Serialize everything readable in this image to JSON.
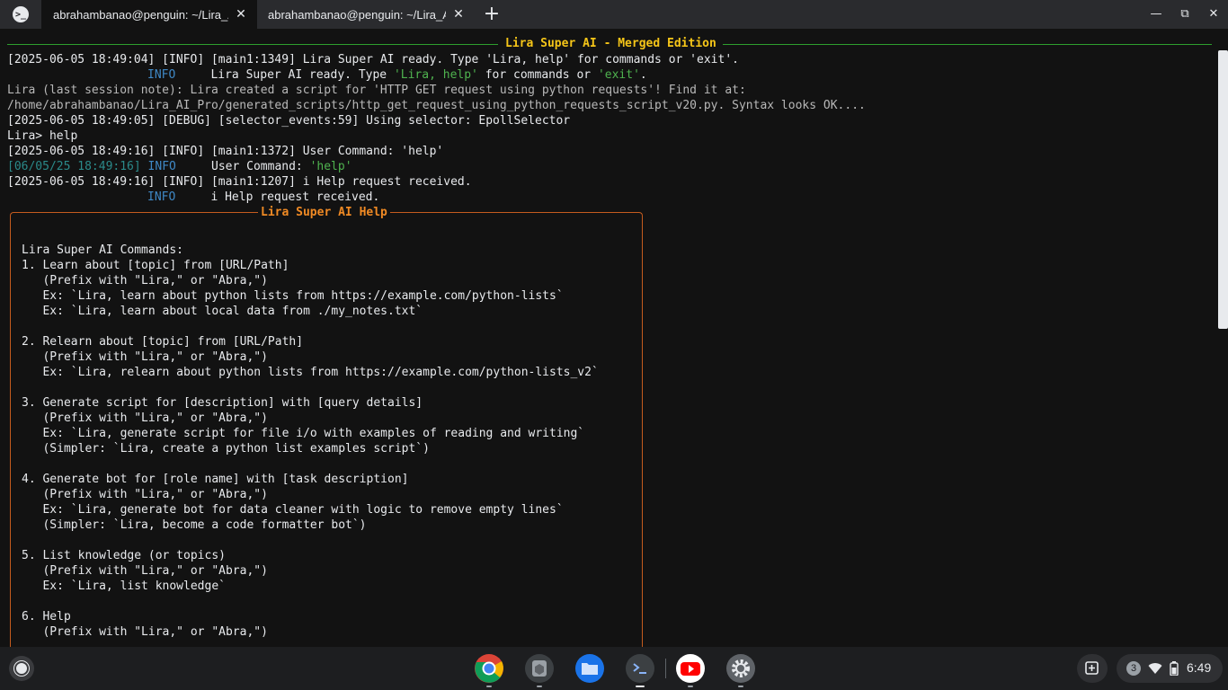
{
  "tabs": [
    {
      "title": "abrahambanao@penguin: ~/Lira_AI_Pro",
      "active": true
    },
    {
      "title": "abrahambanao@penguin: ~/Lira_AI_Pro",
      "active": false
    }
  ],
  "window_controls": {
    "minimize": "—",
    "maximize": "⧉",
    "close": "✕"
  },
  "banner": {
    "title": "Lira Super AI - Merged Edition"
  },
  "log_lines": [
    "[2025-06-05 18:49:04] [INFO] [main1:1349] Lira Super AI ready. Type 'Lira, help' for commands or 'exit'.",
    "Lira (last session note): Lira created a script for 'HTTP GET request using python requests'! Find it at:",
    "/home/abrahambanao/Lira_AI_Pro/generated_scripts/http_get_request_using_python_requests_script_v20.py. Syntax looks OK....",
    "[2025-06-05 18:49:05] [DEBUG] [selector_events:59] Using selector: EpollSelector",
    "Lira> help",
    "[2025-06-05 18:49:16] [INFO] [main1:1372] User Command: 'help'",
    "[2025-06-05 18:49:16] [INFO] [main1:1207] i Help request received."
  ],
  "rich_lines": {
    "info1_level": "INFO",
    "info1_a": "Lira Super AI ready. Type ",
    "info1_b": "'Lira, help'",
    "info1_c": " for commands or ",
    "info1_d": "'exit'",
    "info1_e": ".",
    "info2_time": "[06/05/25 18:49:16]",
    "info2_level": "INFO",
    "info2_a": "User Command: ",
    "info2_b": "'help'",
    "info3_level": "INFO",
    "info3_a": "i Help request received."
  },
  "help": {
    "title": "Lira Super AI Help",
    "lines": [
      "Lira Super AI Commands:",
      "1. Learn about [topic] from [URL/Path]",
      "   (Prefix with \"Lira,\" or \"Abra,\")",
      "   Ex: `Lira, learn about python lists from https://example.com/python-lists`",
      "   Ex: `Lira, learn about local data from ./my_notes.txt`",
      "",
      "2. Relearn about [topic] from [URL/Path]",
      "   (Prefix with \"Lira,\" or \"Abra,\")",
      "   Ex: `Lira, relearn about python lists from https://example.com/python-lists_v2`",
      "",
      "3. Generate script for [description] with [query details]",
      "   (Prefix with \"Lira,\" or \"Abra,\")",
      "   Ex: `Lira, generate script for file i/o with examples of reading and writing`",
      "   (Simpler: `Lira, create a python list examples script`)",
      "",
      "4. Generate bot for [role name] with [task description]",
      "   (Prefix with \"Lira,\" or \"Abra,\")",
      "   Ex: `Lira, generate bot for data cleaner with logic to remove empty lines`",
      "   (Simpler: `Lira, become a code formatter bot`)",
      "",
      "5. List knowledge (or topics)",
      "   (Prefix with \"Lira,\" or \"Abra,\")",
      "   Ex: `Lira, list knowledge`",
      "",
      "6. Help",
      "   (Prefix with \"Lira,\" or \"Abra,\")"
    ]
  },
  "tray": {
    "notification_count": "3",
    "time": "6:49"
  },
  "shelf_apps": [
    "chrome-icon",
    "app-icon",
    "files-icon",
    "terminal-icon",
    "youtube-icon",
    "settings-icon"
  ],
  "colors": {
    "banner_rule": "#2e9f2e",
    "banner_title": "#f5c518",
    "help_border": "#c45b1e",
    "help_title": "#f08a24",
    "info_level": "#3f88c5",
    "string": "#4fb34f"
  }
}
